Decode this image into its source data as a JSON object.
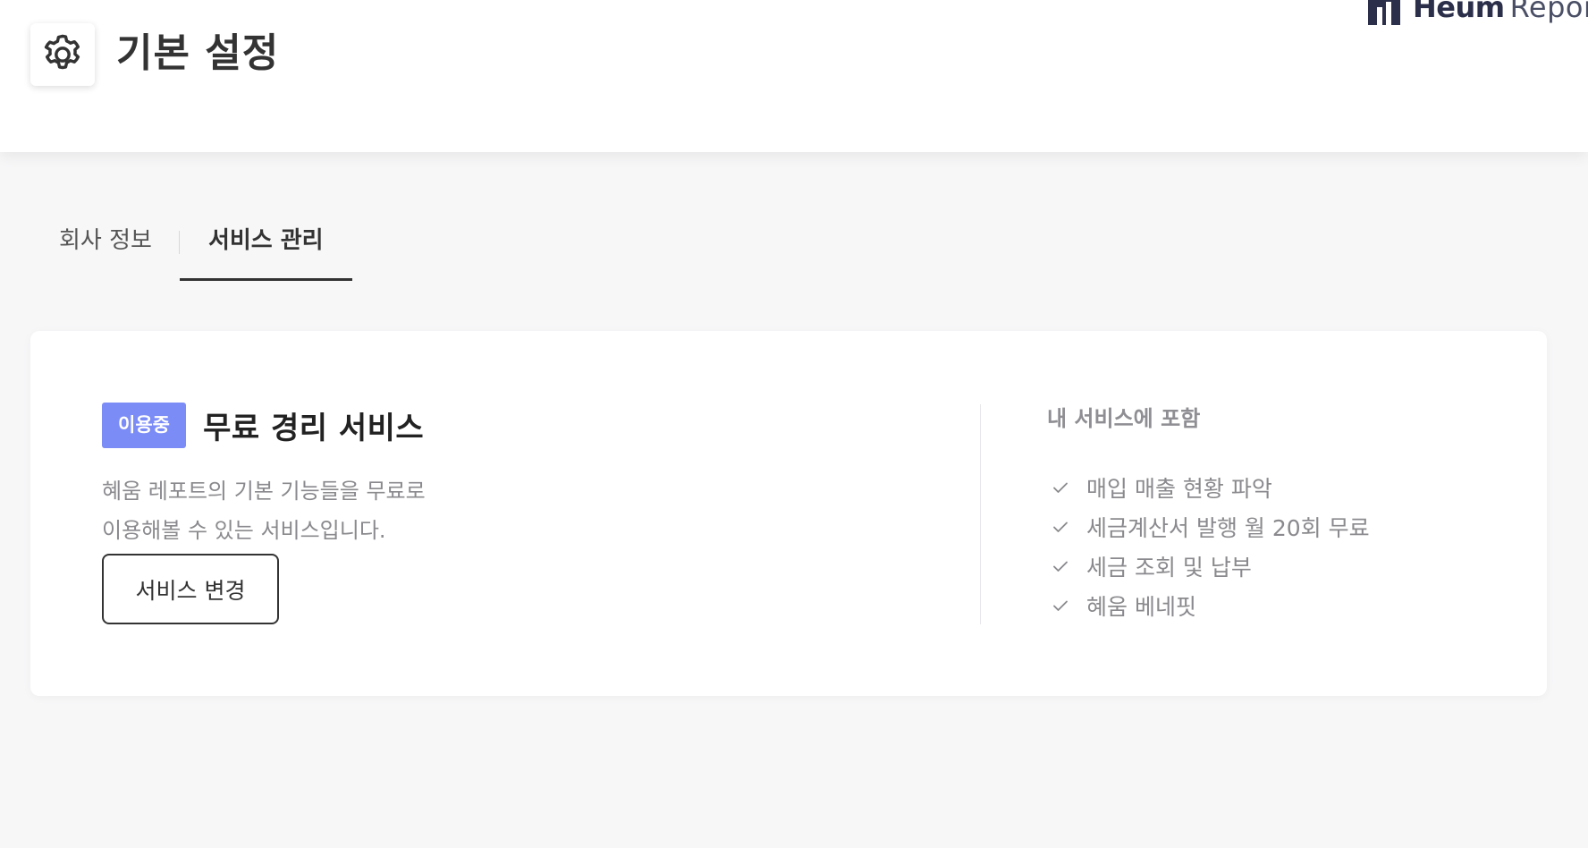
{
  "header": {
    "title": "기본 설정",
    "gear_icon": "gear-icon",
    "logo": {
      "brand_bold": "Heum",
      "brand_light": "Report"
    }
  },
  "tabs": [
    {
      "label": "회사 정보",
      "active": false
    },
    {
      "label": "서비스 관리",
      "active": true
    }
  ],
  "service_card": {
    "status_badge": "이용중",
    "service_name": "무료 경리 서비스",
    "description_line1": "혜움 레포트의 기본 기능들을 무료로",
    "description_line2": "이용해볼 수 있는 서비스입니다.",
    "change_button": "서비스 변경",
    "included_title": "내 서비스에 포함",
    "features": [
      "매입 매출 현황 파악",
      "세금계산서 발행 월 20회 무료",
      "세금 조회 및 납부",
      "혜움 베네핏"
    ]
  },
  "colors": {
    "badge": "#7b8cf7",
    "background": "#f7f7f8",
    "text_dark": "#333333",
    "text_muted": "#8a8a8e",
    "logo_navy": "#2b2f4a"
  }
}
